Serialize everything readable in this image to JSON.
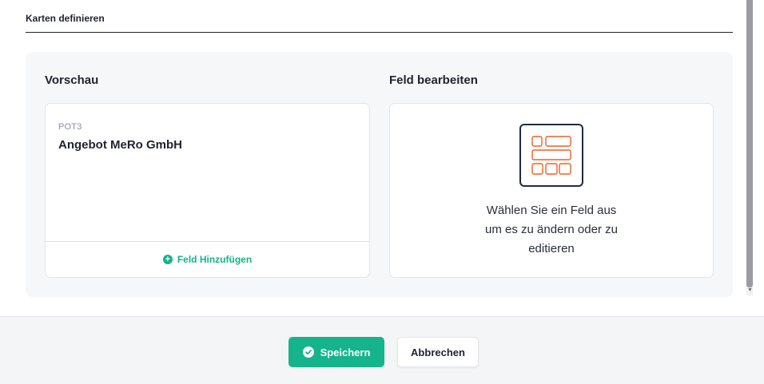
{
  "section": {
    "title": "Karten definieren"
  },
  "preview": {
    "heading": "Vorschau",
    "card": {
      "code": "POT3",
      "title": "Angebot MeRo GmbH",
      "add_field_label": "Feld Hinzufügen"
    }
  },
  "edit": {
    "heading": "Feld bearbeiten",
    "hint_lines": [
      "Wählen Sie ein Feld aus",
      "um es zu ändern oder zu",
      "editieren"
    ],
    "icon": "field-layout-icon"
  },
  "footer": {
    "save_label": "Speichern",
    "cancel_label": "Abbrechen"
  },
  "colors": {
    "accent": "#16b48c",
    "icon_orange": "#e8622a",
    "icon_frame": "#1f2a44"
  }
}
